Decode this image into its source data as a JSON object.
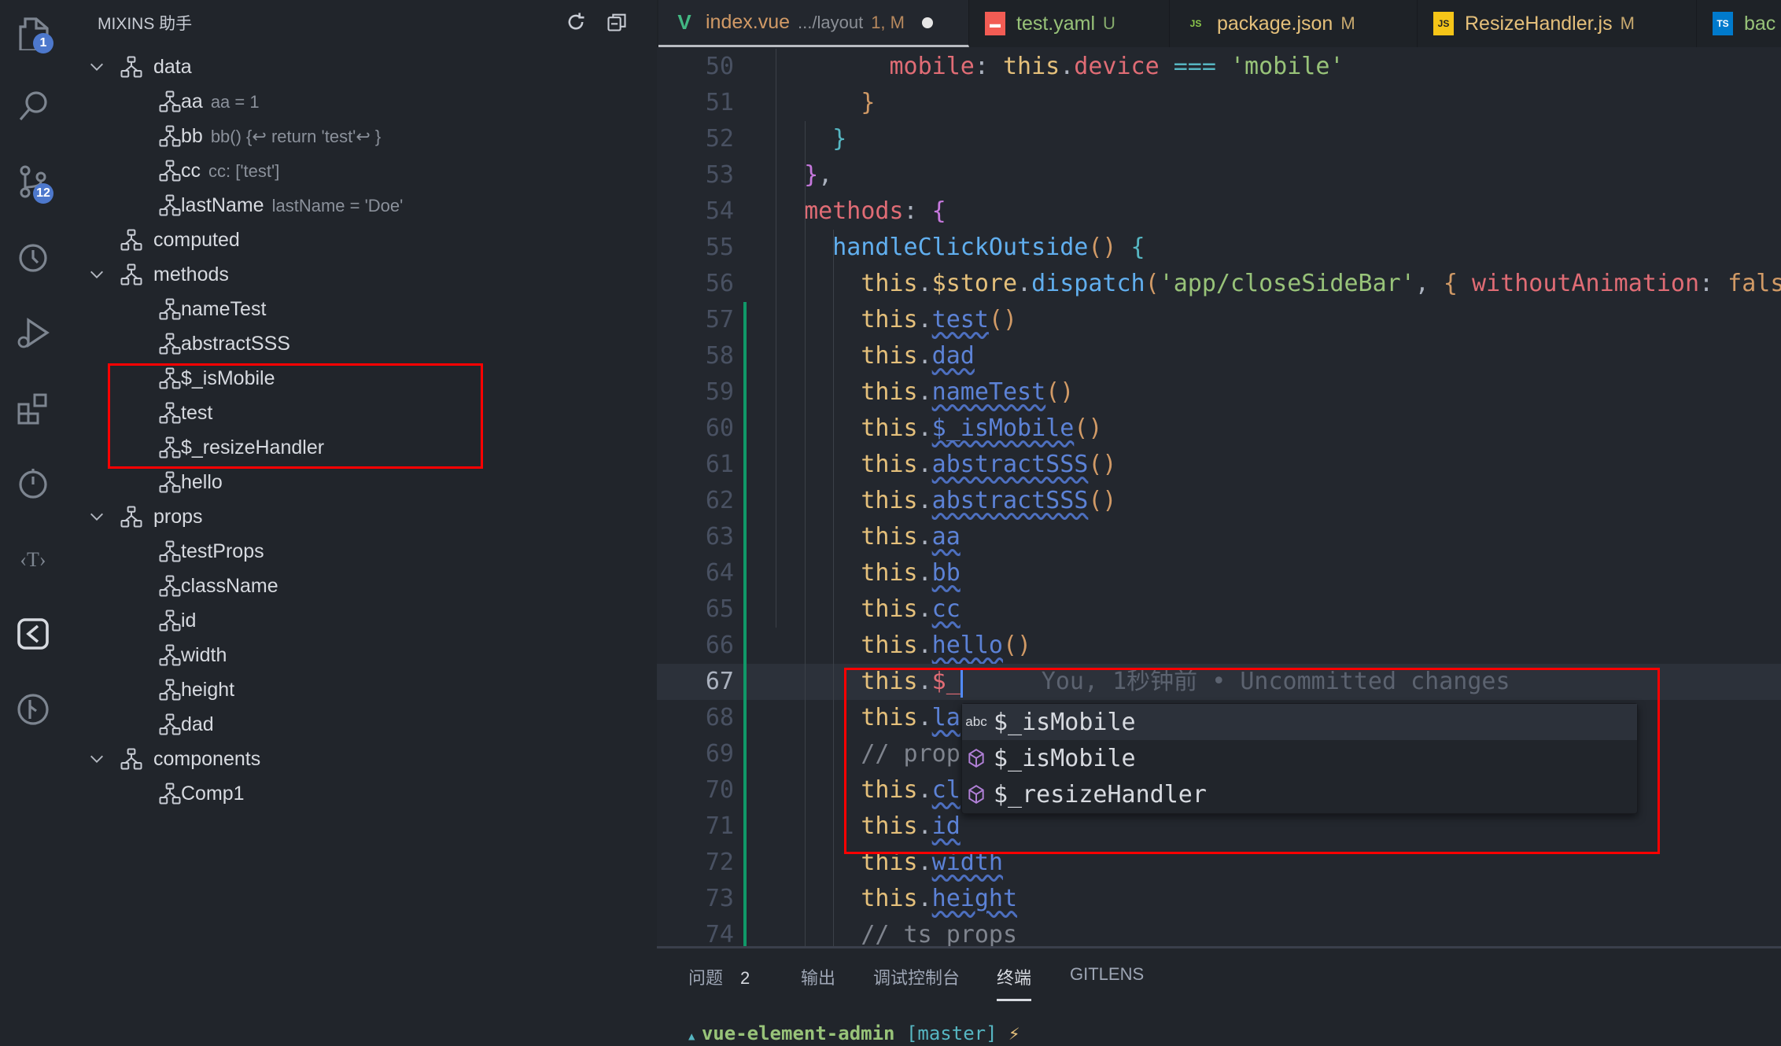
{
  "activity_bar": [
    {
      "name": "explorer-icon",
      "badge": "1"
    },
    {
      "name": "search-icon"
    },
    {
      "name": "source-control-icon",
      "badge": "12"
    },
    {
      "name": "git-history-icon"
    },
    {
      "name": "run-debug-icon"
    },
    {
      "name": "extensions-icon"
    },
    {
      "name": "timeline-icon"
    },
    {
      "name": "translate-icon"
    },
    {
      "name": "mixins-helper-icon"
    },
    {
      "name": "git-graph-icon"
    }
  ],
  "sidebar": {
    "title": "MIXINS 助手",
    "tree": [
      {
        "label": "data",
        "level": 1,
        "expanded": true
      },
      {
        "label": "aa",
        "desc": "aa = 1",
        "level": 2
      },
      {
        "label": "bb",
        "desc": "bb() {⏎      return 'test'⏎    }",
        "level": 2
      },
      {
        "label": "cc",
        "desc": "cc: ['test']",
        "level": 2
      },
      {
        "label": "lastName",
        "desc": "lastName = 'Doe'",
        "level": 2
      },
      {
        "label": "computed",
        "level": 1,
        "expanded": false,
        "chevron": false
      },
      {
        "label": "methods",
        "level": 1,
        "expanded": true
      },
      {
        "label": "nameTest",
        "level": 2
      },
      {
        "label": "abstractSSS",
        "level": 2
      },
      {
        "label": "$_isMobile",
        "level": 2
      },
      {
        "label": "test",
        "level": 2
      },
      {
        "label": "$_resizeHandler",
        "level": 2
      },
      {
        "label": "hello",
        "level": 2
      },
      {
        "label": "props",
        "level": 1,
        "expanded": true
      },
      {
        "label": "testProps",
        "level": 2
      },
      {
        "label": "className",
        "level": 2
      },
      {
        "label": "id",
        "level": 2
      },
      {
        "label": "width",
        "level": 2
      },
      {
        "label": "height",
        "level": 2
      },
      {
        "label": "dad",
        "level": 2
      },
      {
        "label": "components",
        "level": 1,
        "expanded": true
      },
      {
        "label": "Comp1",
        "level": 2
      }
    ]
  },
  "tabs": [
    {
      "name": "index.vue",
      "path": ".../layout",
      "status": "1, M",
      "icon": "vue-icon",
      "color": "#d19a66",
      "active": true,
      "dirty": true
    },
    {
      "name": "test.yaml",
      "status": "U",
      "icon": "yaml-icon",
      "color": "#98c379"
    },
    {
      "name": "package.json",
      "status": "M",
      "icon": "nodejs-icon",
      "color": "#e5c07b"
    },
    {
      "name": "ResizeHandler.js",
      "status": "M",
      "icon": "js-icon",
      "color": "#e5c07b"
    },
    {
      "name": "bac",
      "icon": "ts-icon",
      "color": "#98c379"
    }
  ],
  "code": [
    {
      "n": "50",
      "i": 8,
      "t": [
        [
          "mobile",
          "prop"
        ],
        [
          ": ",
          "p"
        ],
        [
          "this",
          "kw"
        ],
        [
          ".",
          "p"
        ],
        [
          "device",
          "prop"
        ],
        [
          " === ",
          "op"
        ],
        [
          "'mobile'",
          "str"
        ]
      ]
    },
    {
      "n": "51",
      "i": 6,
      "t": [
        [
          "}",
          "br1"
        ]
      ]
    },
    {
      "n": "52",
      "i": 4,
      "t": [
        [
          "}",
          "br2"
        ]
      ]
    },
    {
      "n": "53",
      "i": 2,
      "t": [
        [
          "}",
          "br3"
        ],
        [
          ",",
          "p"
        ]
      ]
    },
    {
      "n": "54",
      "i": 2,
      "t": [
        [
          "methods",
          "prop"
        ],
        [
          ": ",
          "p"
        ],
        [
          "{",
          "br3"
        ]
      ]
    },
    {
      "n": "55",
      "i": 4,
      "t": [
        [
          "handleClickOutside",
          "fn"
        ],
        [
          "()",
          "br1"
        ],
        [
          " ",
          "p"
        ],
        [
          "{",
          "br2"
        ]
      ]
    },
    {
      "n": "56",
      "i": 6,
      "t": [
        [
          "this",
          "kw"
        ],
        [
          ".",
          "p"
        ],
        [
          "$store",
          "kw"
        ],
        [
          ".",
          "p"
        ],
        [
          "dispatch",
          "fn"
        ],
        [
          "(",
          "br1"
        ],
        [
          "'app/closeSideBar'",
          "str"
        ],
        [
          ", ",
          "p"
        ],
        [
          "{ ",
          "br1"
        ],
        [
          "withoutAnimation",
          "prop"
        ],
        [
          ": ",
          "p"
        ],
        [
          "false",
          "num"
        ]
      ]
    },
    {
      "n": "57",
      "i": 6,
      "t": [
        [
          "this",
          "kw"
        ],
        [
          ".",
          "p"
        ],
        [
          "test",
          "err"
        ],
        [
          "()",
          "br1"
        ]
      ]
    },
    {
      "n": "58",
      "i": 6,
      "t": [
        [
          "this",
          "kw"
        ],
        [
          ".",
          "p"
        ],
        [
          "dad",
          "err"
        ]
      ]
    },
    {
      "n": "59",
      "i": 6,
      "t": [
        [
          "this",
          "kw"
        ],
        [
          ".",
          "p"
        ],
        [
          "nameTest",
          "err"
        ],
        [
          "()",
          "br1"
        ]
      ]
    },
    {
      "n": "60",
      "i": 6,
      "t": [
        [
          "this",
          "kw"
        ],
        [
          ".",
          "p"
        ],
        [
          "$_isMobile",
          "err"
        ],
        [
          "()",
          "br1"
        ]
      ]
    },
    {
      "n": "61",
      "i": 6,
      "t": [
        [
          "this",
          "kw"
        ],
        [
          ".",
          "p"
        ],
        [
          "abstractSSS",
          "err"
        ],
        [
          "()",
          "br1"
        ]
      ]
    },
    {
      "n": "62",
      "i": 6,
      "t": [
        [
          "this",
          "kw"
        ],
        [
          ".",
          "p"
        ],
        [
          "abstractSSS",
          "err"
        ],
        [
          "()",
          "br1"
        ]
      ]
    },
    {
      "n": "63",
      "i": 6,
      "t": [
        [
          "this",
          "kw"
        ],
        [
          ".",
          "p"
        ],
        [
          "aa",
          "err"
        ]
      ]
    },
    {
      "n": "64",
      "i": 6,
      "t": [
        [
          "this",
          "kw"
        ],
        [
          ".",
          "p"
        ],
        [
          "bb",
          "err"
        ]
      ]
    },
    {
      "n": "65",
      "i": 6,
      "t": [
        [
          "this",
          "kw"
        ],
        [
          ".",
          "p"
        ],
        [
          "cc",
          "err"
        ]
      ]
    },
    {
      "n": "66",
      "i": 6,
      "t": [
        [
          "this",
          "kw"
        ],
        [
          ".",
          "p"
        ],
        [
          "hello",
          "err"
        ],
        [
          "()",
          "br1"
        ]
      ]
    },
    {
      "n": "67",
      "i": 6,
      "cur": true,
      "t": [
        [
          "this",
          "kw"
        ],
        [
          ".",
          "p"
        ],
        [
          "$_",
          "cur"
        ]
      ],
      "blame": "You, 1秒钟前 • Uncommitted changes"
    },
    {
      "n": "68",
      "i": 6,
      "t": [
        [
          "this",
          "kw"
        ],
        [
          ".",
          "p"
        ],
        [
          "la",
          "err"
        ]
      ]
    },
    {
      "n": "69",
      "i": 6,
      "t": [
        [
          "// prop",
          "cm"
        ]
      ]
    },
    {
      "n": "70",
      "i": 6,
      "t": [
        [
          "this",
          "kw"
        ],
        [
          ".",
          "p"
        ],
        [
          "cl",
          "err"
        ]
      ]
    },
    {
      "n": "71",
      "i": 6,
      "t": [
        [
          "this",
          "kw"
        ],
        [
          ".",
          "p"
        ],
        [
          "id",
          "err"
        ]
      ]
    },
    {
      "n": "72",
      "i": 6,
      "t": [
        [
          "this",
          "kw"
        ],
        [
          ".",
          "p"
        ],
        [
          "width",
          "err"
        ]
      ]
    },
    {
      "n": "73",
      "i": 6,
      "t": [
        [
          "this",
          "kw"
        ],
        [
          ".",
          "p"
        ],
        [
          "height",
          "err"
        ]
      ]
    },
    {
      "n": "74",
      "i": 6,
      "t": [
        [
          "// ts props",
          "cm"
        ]
      ]
    }
  ],
  "suggestions": [
    {
      "label": "$_isMobile",
      "icon": "text-abc-icon",
      "icon_text": "abc",
      "selected": true
    },
    {
      "label": "$_isMobile",
      "icon": "method-cube-icon"
    },
    {
      "label": "$_resizeHandler",
      "icon": "method-cube-icon"
    }
  ],
  "panel": {
    "tabs": [
      {
        "label": "问题",
        "count": "2"
      },
      {
        "label": "输出"
      },
      {
        "label": "调试控制台"
      },
      {
        "label": "终端",
        "active": true
      },
      {
        "label": "GITLENS"
      }
    ],
    "terminal": {
      "dir": "vue-element-admin",
      "branch": "[master]",
      "symbol": "⚡"
    }
  },
  "colors": {
    "accent": "#4d78cc",
    "highlight_box": "#ff0000",
    "git_added": "#109868"
  }
}
